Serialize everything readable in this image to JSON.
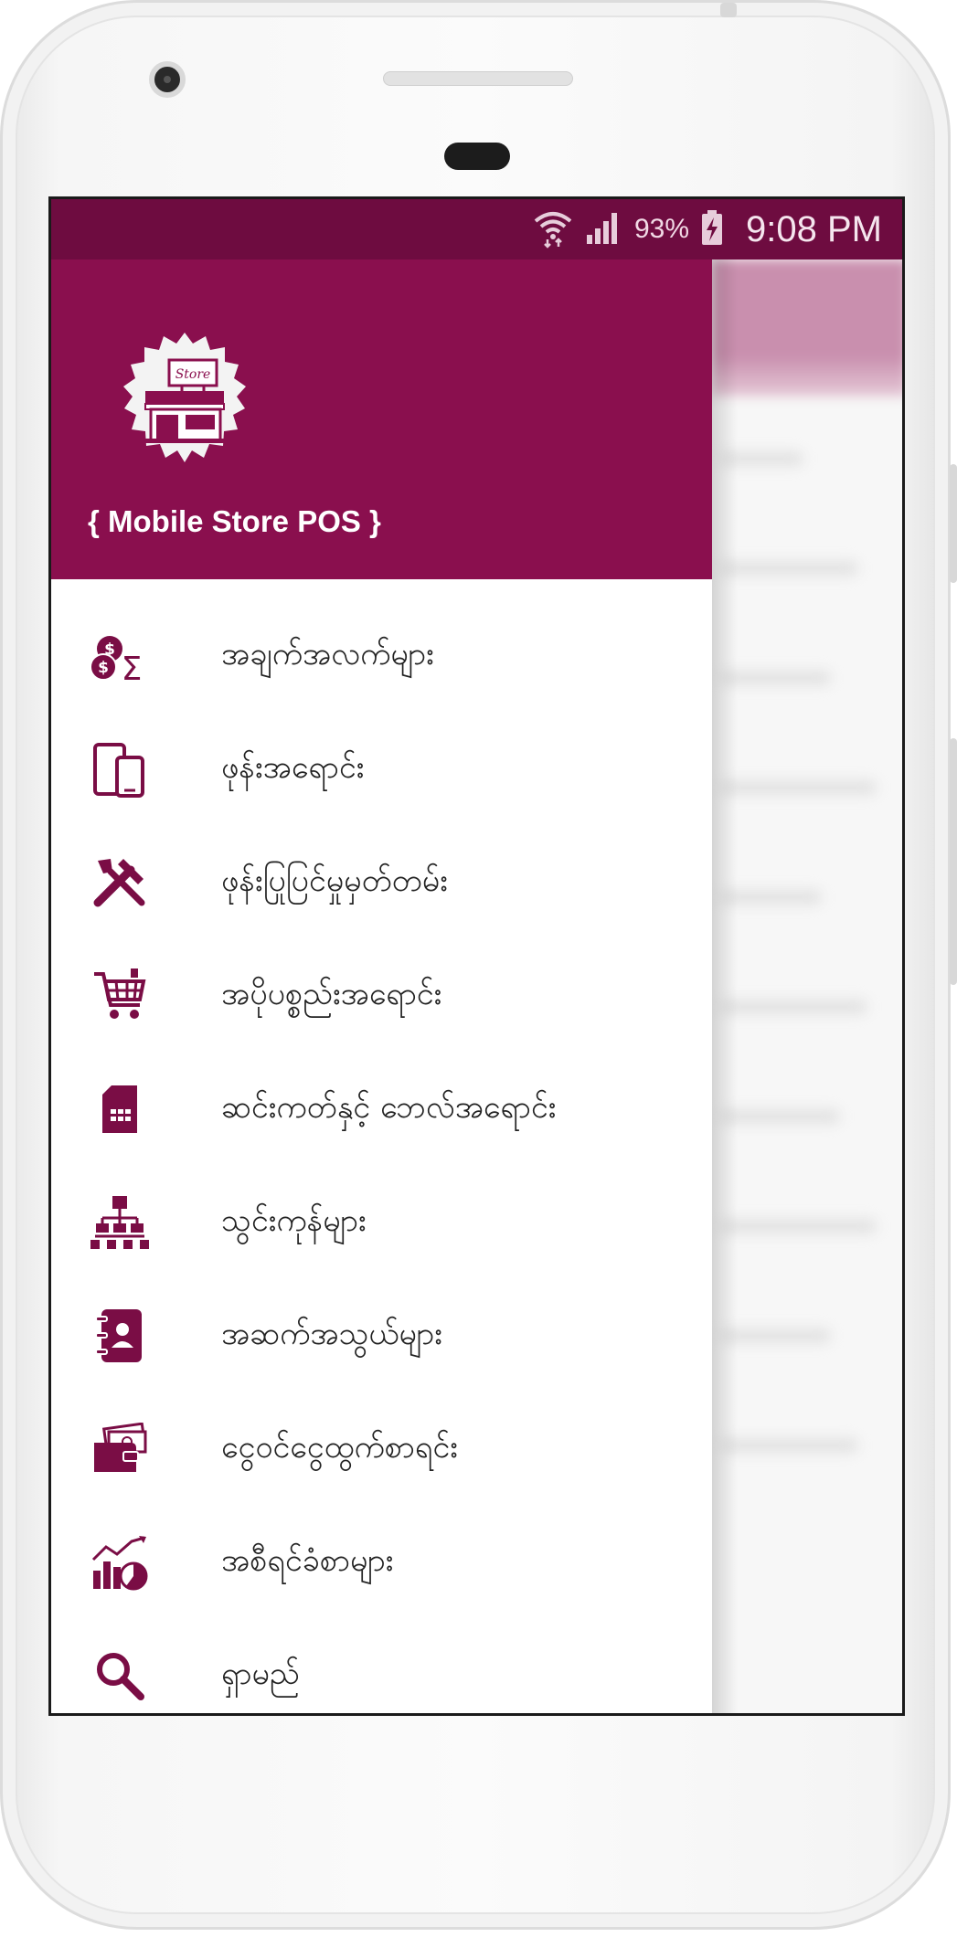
{
  "status_bar": {
    "battery_percent": "93%",
    "time": "9:08 PM",
    "icons": [
      "wifi-icon",
      "signal-icon",
      "battery-charging-icon"
    ]
  },
  "drawer": {
    "app_name": "{ Mobile Store POS }",
    "logo_text": "Store",
    "items": [
      {
        "label": "အချက်အလက်များ",
        "icon": "sales-summary-icon"
      },
      {
        "label": "ဖုန်းအရောင်း",
        "icon": "phones-icon"
      },
      {
        "label": "ဖုန်းပြုပြင်မှုမှတ်တမ်း",
        "icon": "repair-tools-icon"
      },
      {
        "label": "အပိုပစ္စည်းအရောင်း",
        "icon": "shopping-cart-icon"
      },
      {
        "label": "ဆင်းကတ်နှင့် ဘေလ်အရောင်း",
        "icon": "sim-card-icon"
      },
      {
        "label": "သွင်းကုန်များ",
        "icon": "hierarchy-icon"
      },
      {
        "label": "အဆက်အသွယ်များ",
        "icon": "contacts-book-icon"
      },
      {
        "label": "ငွေဝင်ငွေထွက်စာရင်း",
        "icon": "wallet-icon"
      },
      {
        "label": "အစီရင်ခံစာများ",
        "icon": "report-chart-icon"
      },
      {
        "label": "ရှာမည်",
        "icon": "search-icon"
      }
    ]
  },
  "colors": {
    "primary": "#8a0f4e",
    "status_bar": "#6e0c40",
    "icon": "#7a0d45"
  }
}
